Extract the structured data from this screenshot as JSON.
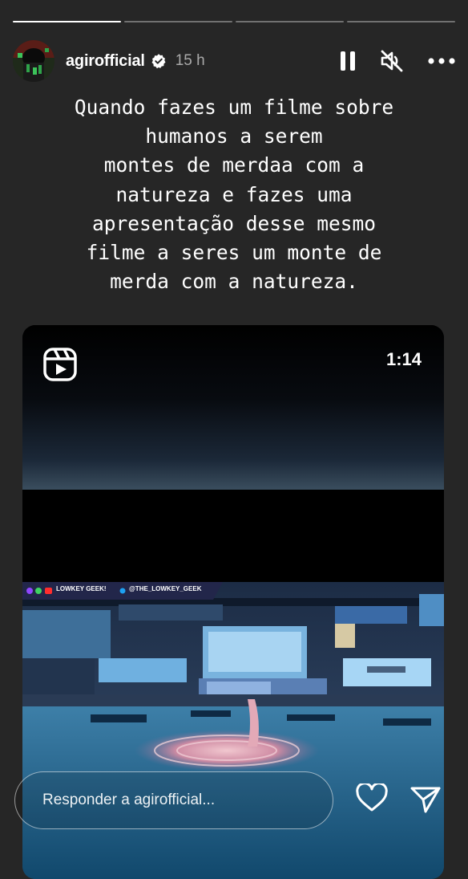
{
  "progress": [
    1.0,
    0.0,
    0.0,
    0.0
  ],
  "header": {
    "username": "agirofficial",
    "time": "15 h",
    "verified": true,
    "actions": [
      "pause-icon",
      "mute-icon",
      "more-icon"
    ]
  },
  "caption": "Quando fazes um filme sobre\nhumanos a serem\nmontes de merdaa com a\nnatureza e fazes uma\napresentação desse mesmo\nfilme a seres um monte de\nmerda com a natureza.",
  "reel": {
    "icon": "reels-icon",
    "duration": "1:14",
    "banner": {
      "channel": "LOWKEY GEEK!",
      "handle": "@THE_LOWKEY_GEEK"
    }
  },
  "reply": {
    "placeholder": "Responder a agirofficial..."
  },
  "footer_actions": [
    "heart-icon",
    "send-icon"
  ],
  "colors": {
    "background": "#262626",
    "text": "#ffffff",
    "muted_text": "#999999"
  }
}
